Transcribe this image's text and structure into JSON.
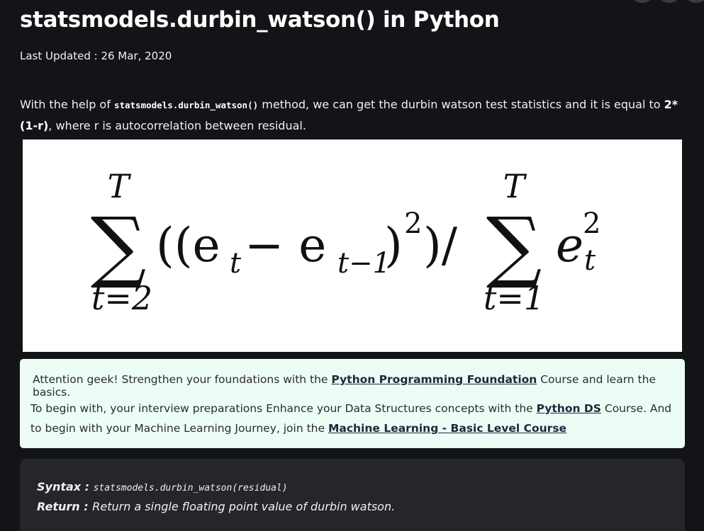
{
  "article": {
    "title": "statsmodels.durbin_watson() in Python",
    "last_updated": "Last Updated : 26 Mar, 2020",
    "intro": {
      "prefix": "With the help of ",
      "code": "statsmodels.durbin_watson()",
      "middle": " method, we can get the durbin watson test statistics and it is equal to ",
      "bold": "2*(1-r)",
      "suffix": ", where r is autocorrelation between residual."
    }
  },
  "formula": {
    "upper_limit_1": "T",
    "lower_limit_1": "t=2",
    "numerator": "((e",
    "sub_t": "t",
    "minus": " − e",
    "sub_t1": "t−1",
    "close": ")",
    "sup_2": "2",
    "close2": ")/",
    "upper_limit_2": "T",
    "lower_limit_2": "t=1",
    "e": "e",
    "sup_2b": "2",
    "sub_tb": "t"
  },
  "attention": {
    "line1_prefix": "Attention geek! Strengthen your foundations with the ",
    "line1_link": "Python Programming Foundation",
    "line1_suffix": " Course and learn the basics.",
    "line2_prefix": "To begin with, your interview preparations Enhance your Data Structures concepts with the ",
    "line2_link": "Python DS",
    "line2_middle": " Course. And to begin with your Machine Learning Journey, join the ",
    "line2_link2": "Machine Learning - Basic Level Course"
  },
  "syntax": {
    "syntax_label": "Syntax : ",
    "syntax_value": "statsmodels.durbin_watson(residual)",
    "return_label": "Return : ",
    "return_value": "Return a single floating point value of durbin watson."
  }
}
